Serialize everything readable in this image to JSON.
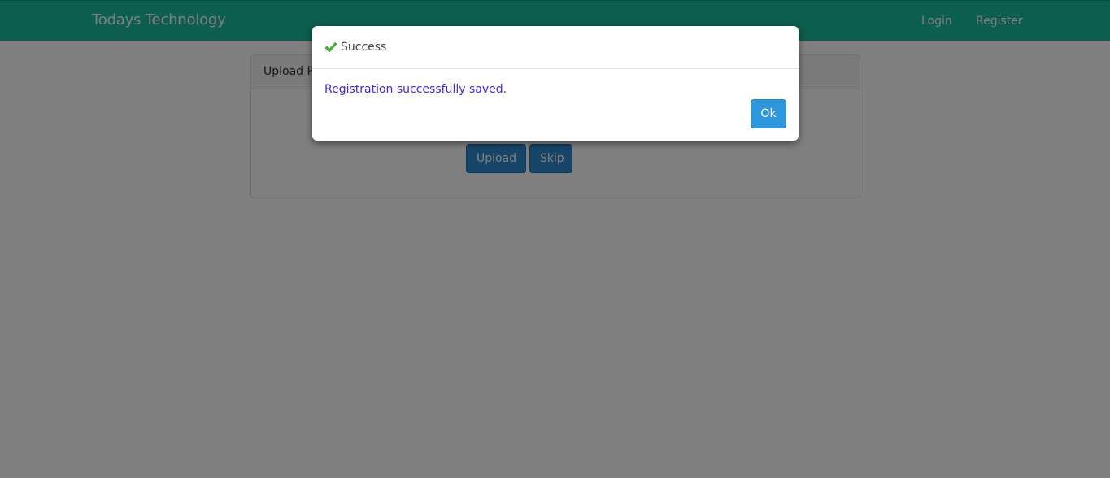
{
  "navbar": {
    "brand": "Todays Technology",
    "links": [
      {
        "label": "Login"
      },
      {
        "label": "Register"
      }
    ],
    "color": "#18bc9c"
  },
  "panel": {
    "heading": "Upload P",
    "upload_label": "Upload",
    "skip_label": "Skip"
  },
  "modal": {
    "title": "Success",
    "message": "Registration successfully saved.",
    "ok_label": "Ok",
    "icon": "check-icon",
    "message_color": "#3e2bd6"
  }
}
